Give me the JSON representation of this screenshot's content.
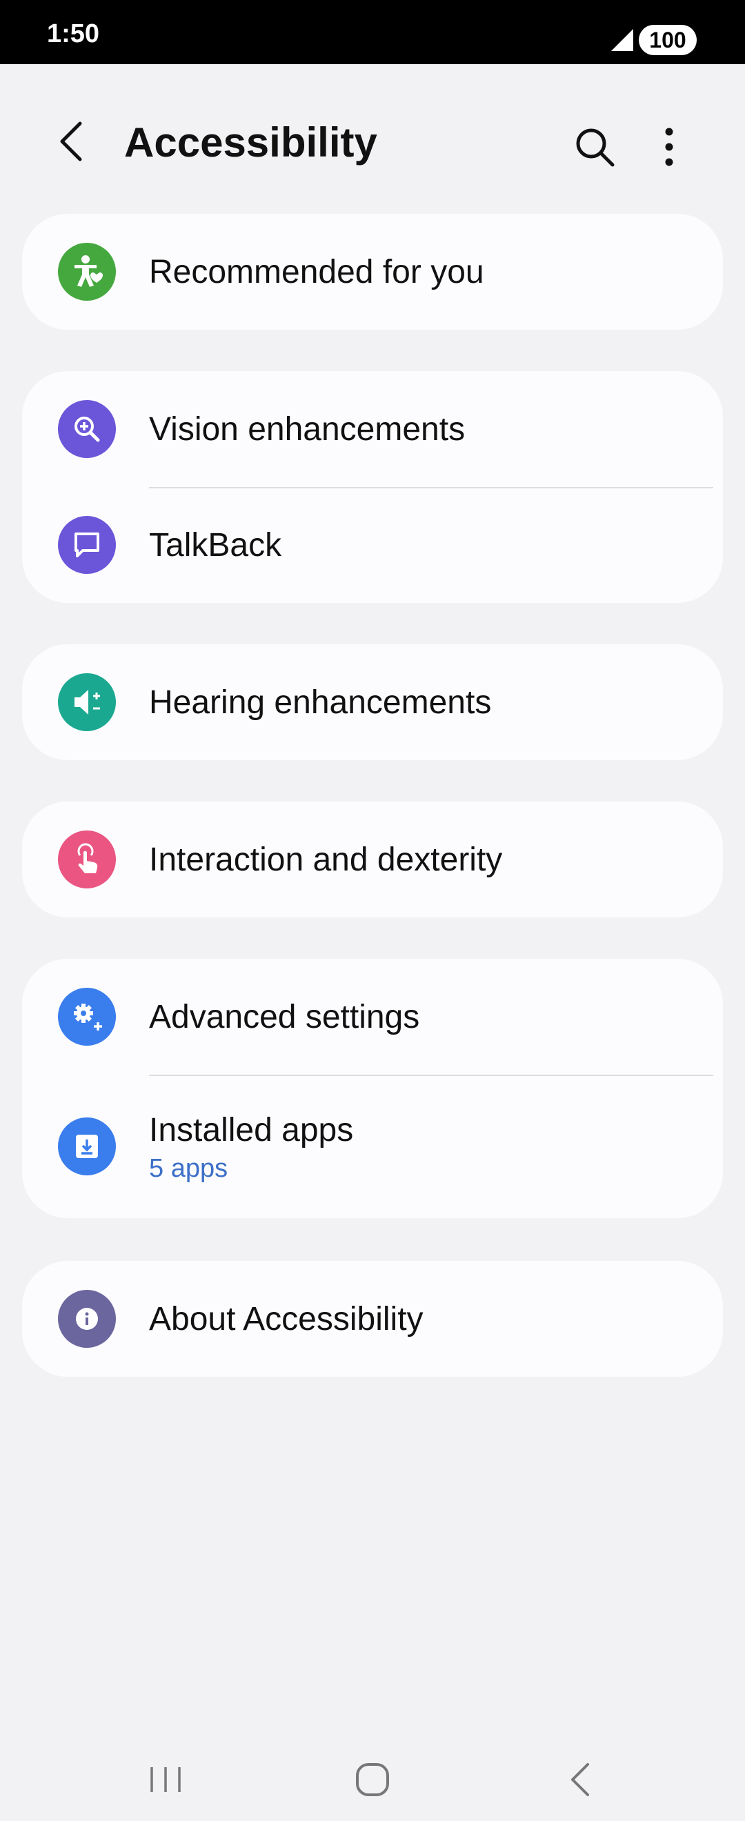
{
  "status_bar": {
    "time": "1:50",
    "battery": "100"
  },
  "header": {
    "title": "Accessibility",
    "back_icon": "back-arrow-icon",
    "search_icon": "search-icon",
    "more_icon": "more-vert-icon"
  },
  "menu": {
    "recommended": {
      "label": "Recommended for you",
      "icon": "accessibility-heart-icon",
      "color": "#45a83f"
    },
    "vision": {
      "label": "Vision enhancements",
      "icon": "zoom-in-icon",
      "color": "#6b55d8"
    },
    "talkback": {
      "label": "TalkBack",
      "icon": "chat-bubble-icon",
      "color": "#6b55d8"
    },
    "hearing": {
      "label": "Hearing enhancements",
      "icon": "volume-adjust-icon",
      "color": "#1ba891"
    },
    "interaction": {
      "label": "Interaction and dexterity",
      "icon": "touch-hand-icon",
      "color": "#ea5582"
    },
    "advanced": {
      "label": "Advanced settings",
      "icon": "gear-plus-icon",
      "color": "#3a7ded"
    },
    "installed": {
      "label": "Installed apps",
      "sublabel": "5 apps",
      "icon": "download-icon",
      "color": "#3a7ded"
    },
    "about": {
      "label": "About Accessibility",
      "icon": "info-icon",
      "color": "#6b669e"
    }
  },
  "nav_bar": {
    "recents_icon": "recents-icon",
    "home_icon": "home-icon",
    "back_icon": "back-icon"
  }
}
